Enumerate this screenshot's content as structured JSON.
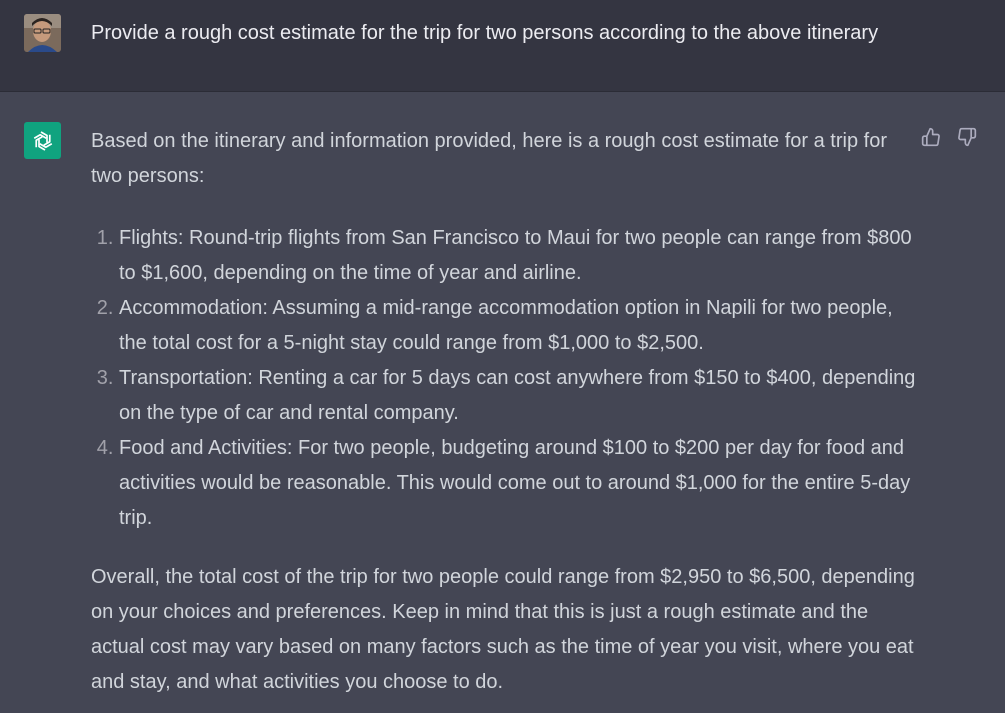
{
  "user": {
    "prompt": "Provide a rough cost estimate for the trip for two persons according to the above itinerary"
  },
  "assistant": {
    "intro": "Based on the itinerary and information provided, here is a rough cost estimate for a trip for two persons:",
    "items": [
      "Flights: Round-trip flights from San Francisco to Maui for two people can range from $800 to $1,600, depending on the time of year and airline.",
      "Accommodation: Assuming a mid-range accommodation option in Napili for two people, the total cost for a 5-night stay could range from $1,000 to $2,500.",
      "Transportation: Renting a car for 5 days can cost anywhere from $150 to $400, depending on the type of car and rental company.",
      "Food and Activities: For two people, budgeting around $100 to $200 per day for food and activities would be reasonable. This would come out to around $1,000 for the entire 5-day trip."
    ],
    "conclusion": "Overall, the total cost of the trip for two people could range from $2,950 to $6,500, depending on your choices and preferences. Keep in mind that this is just a rough estimate and the actual cost may vary based on many factors such as the time of year you visit, where you eat and stay, and what activities you choose to do."
  },
  "icons": {
    "avatar": "user-avatar",
    "logo": "openai-logo-icon",
    "like": "thumbs-up-icon",
    "dislike": "thumbs-down-icon"
  },
  "colors": {
    "user_bg": "#343541",
    "assistant_bg": "#444654",
    "logo_bg": "#10a37f",
    "text": "#d1d5db"
  }
}
